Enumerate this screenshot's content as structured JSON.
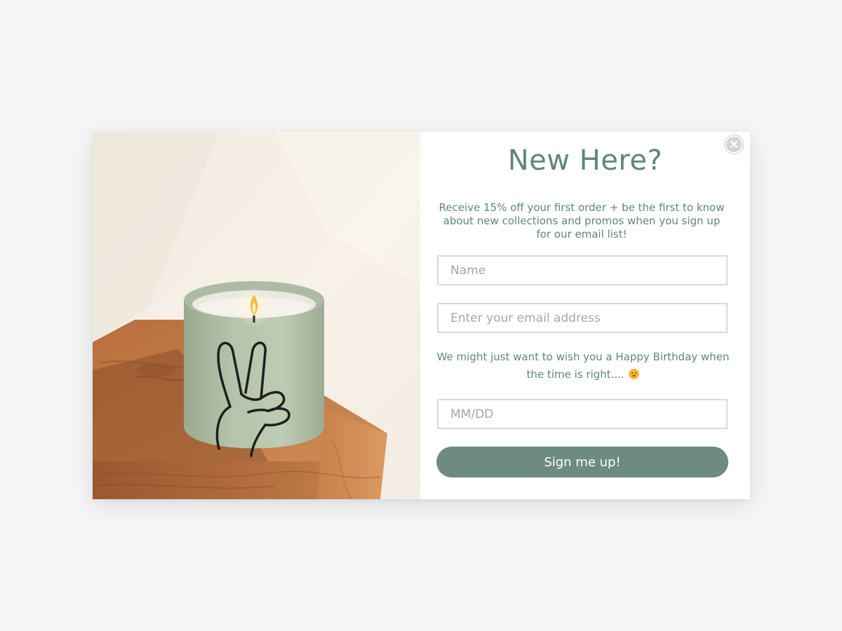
{
  "popup": {
    "title": "New Here?",
    "intro": "Receive 15% off your first order + be the first to know about new collections and promos when you sign up for our email list!",
    "name_placeholder": "Name",
    "email_placeholder": "Enter your email address",
    "birthday_note": "We might just want to wish you a Happy Birthday when the time is right....",
    "birthday_emoji": "shushing-face-emoji",
    "birthday_placeholder": "MM/DD",
    "submit_label": "Sign me up!",
    "close_icon": "close-icon",
    "hero_image": "candle-with-peace-sign-on-wooden-block"
  },
  "colors": {
    "accent_text": "#5f8778",
    "button": "#6d8b80",
    "page_background": "#f5f5f5",
    "input_border": "#d7d9dc"
  }
}
